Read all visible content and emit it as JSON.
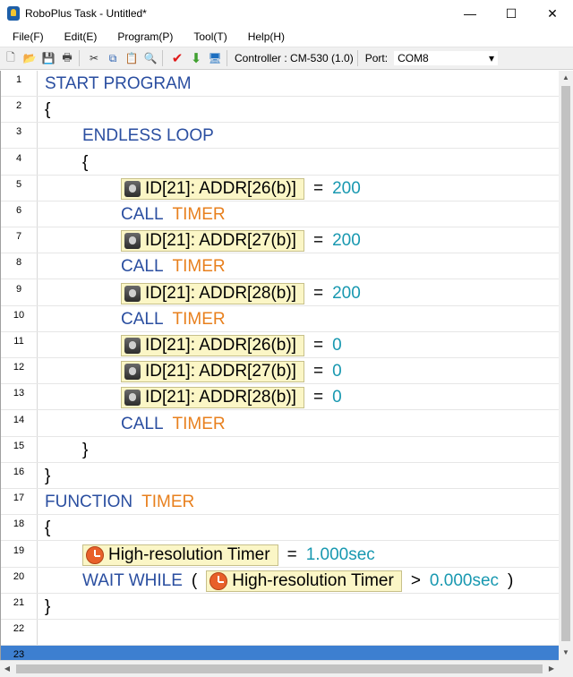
{
  "window": {
    "title": "RoboPlus Task - Untitled*",
    "minimize": "—",
    "maximize": "☐",
    "close": "✕"
  },
  "menu": [
    "File(F)",
    "Edit(E)",
    "Program(P)",
    "Tool(T)",
    "Help(H)"
  ],
  "toolbar": {
    "controller_label": "Controller : CM-530 (1.0)",
    "port_label": "Port:",
    "port_value": "COM8",
    "port_arrow": "▾",
    "icons": {
      "new": "🗋",
      "open": "📂",
      "save": "💾",
      "print": "🖶",
      "cut": "✂",
      "copy": "⧉",
      "paste": "📋",
      "find": "🔍",
      "check": "✔",
      "download": "⬇",
      "monitor": "🖥"
    }
  },
  "lines": [
    {
      "n": "1",
      "indent": 0,
      "tokens": [
        {
          "t": "START PROGRAM",
          "c": "kw"
        }
      ]
    },
    {
      "n": "2",
      "indent": 0,
      "tokens": [
        {
          "t": "{",
          "c": "blk"
        }
      ]
    },
    {
      "n": "3",
      "indent": 1,
      "tokens": [
        {
          "t": "ENDLESS LOOP",
          "c": "kw"
        }
      ]
    },
    {
      "n": "4",
      "indent": 1,
      "tokens": [
        {
          "t": "{",
          "c": "blk"
        }
      ]
    },
    {
      "n": "5",
      "indent": 2,
      "tokens": [
        {
          "chip": "ID[21]: ADDR[26(b)]",
          "icon": "dev"
        },
        {
          "t": "=",
          "c": "blk"
        },
        {
          "t": "200",
          "c": "num"
        }
      ]
    },
    {
      "n": "6",
      "indent": 2,
      "tokens": [
        {
          "t": "CALL",
          "c": "kw"
        },
        {
          "t": "TIMER",
          "c": "fn"
        }
      ]
    },
    {
      "n": "7",
      "indent": 2,
      "tokens": [
        {
          "chip": "ID[21]: ADDR[27(b)]",
          "icon": "dev"
        },
        {
          "t": "=",
          "c": "blk"
        },
        {
          "t": "200",
          "c": "num"
        }
      ]
    },
    {
      "n": "8",
      "indent": 2,
      "tokens": [
        {
          "t": "CALL",
          "c": "kw"
        },
        {
          "t": "TIMER",
          "c": "fn"
        }
      ]
    },
    {
      "n": "9",
      "indent": 2,
      "tokens": [
        {
          "chip": "ID[21]: ADDR[28(b)]",
          "icon": "dev"
        },
        {
          "t": "=",
          "c": "blk"
        },
        {
          "t": "200",
          "c": "num"
        }
      ]
    },
    {
      "n": "10",
      "indent": 2,
      "tokens": [
        {
          "t": "CALL",
          "c": "kw"
        },
        {
          "t": "TIMER",
          "c": "fn"
        }
      ]
    },
    {
      "n": "11",
      "indent": 2,
      "tokens": [
        {
          "chip": "ID[21]: ADDR[26(b)]",
          "icon": "dev"
        },
        {
          "t": "=",
          "c": "blk"
        },
        {
          "t": "0",
          "c": "num"
        }
      ]
    },
    {
      "n": "12",
      "indent": 2,
      "tokens": [
        {
          "chip": "ID[21]: ADDR[27(b)]",
          "icon": "dev"
        },
        {
          "t": "=",
          "c": "blk"
        },
        {
          "t": "0",
          "c": "num"
        }
      ]
    },
    {
      "n": "13",
      "indent": 2,
      "tokens": [
        {
          "chip": "ID[21]: ADDR[28(b)]",
          "icon": "dev"
        },
        {
          "t": "=",
          "c": "blk"
        },
        {
          "t": "0",
          "c": "num"
        }
      ]
    },
    {
      "n": "14",
      "indent": 2,
      "tokens": [
        {
          "t": "CALL",
          "c": "kw"
        },
        {
          "t": "TIMER",
          "c": "fn"
        }
      ]
    },
    {
      "n": "15",
      "indent": 1,
      "tokens": [
        {
          "t": "}",
          "c": "blk"
        }
      ]
    },
    {
      "n": "16",
      "indent": 0,
      "tokens": [
        {
          "t": "}",
          "c": "blk"
        }
      ]
    },
    {
      "n": "17",
      "indent": 0,
      "tokens": [
        {
          "t": "FUNCTION",
          "c": "kw"
        },
        {
          "t": "TIMER",
          "c": "fn"
        }
      ]
    },
    {
      "n": "18",
      "indent": 0,
      "tokens": [
        {
          "t": "{",
          "c": "blk"
        }
      ]
    },
    {
      "n": "19",
      "indent": 1,
      "tokens": [
        {
          "chip": "High-resolution Timer",
          "icon": "clock"
        },
        {
          "t": "=",
          "c": "blk"
        },
        {
          "t": "1.000sec",
          "c": "num"
        }
      ]
    },
    {
      "n": "20",
      "indent": 1,
      "tokens": [
        {
          "t": "WAIT WHILE",
          "c": "kw"
        },
        {
          "t": "(",
          "c": "blk"
        },
        {
          "chip": "High-resolution Timer",
          "icon": "clock"
        },
        {
          "t": ">",
          "c": "blk"
        },
        {
          "t": "0.000sec",
          "c": "num"
        },
        {
          "t": ")",
          "c": "blk"
        }
      ]
    },
    {
      "n": "21",
      "indent": 0,
      "tokens": [
        {
          "t": "}",
          "c": "blk"
        }
      ]
    },
    {
      "n": "22",
      "indent": 0,
      "tokens": []
    },
    {
      "n": "23",
      "indent": 0,
      "tokens": [],
      "selected": true
    }
  ],
  "colors": {
    "keyword": "#2a4ea0",
    "function": "#e8801e",
    "number": "#1898b0",
    "chip_bg": "#fbf6c6",
    "selection": "#3d7fd0"
  }
}
